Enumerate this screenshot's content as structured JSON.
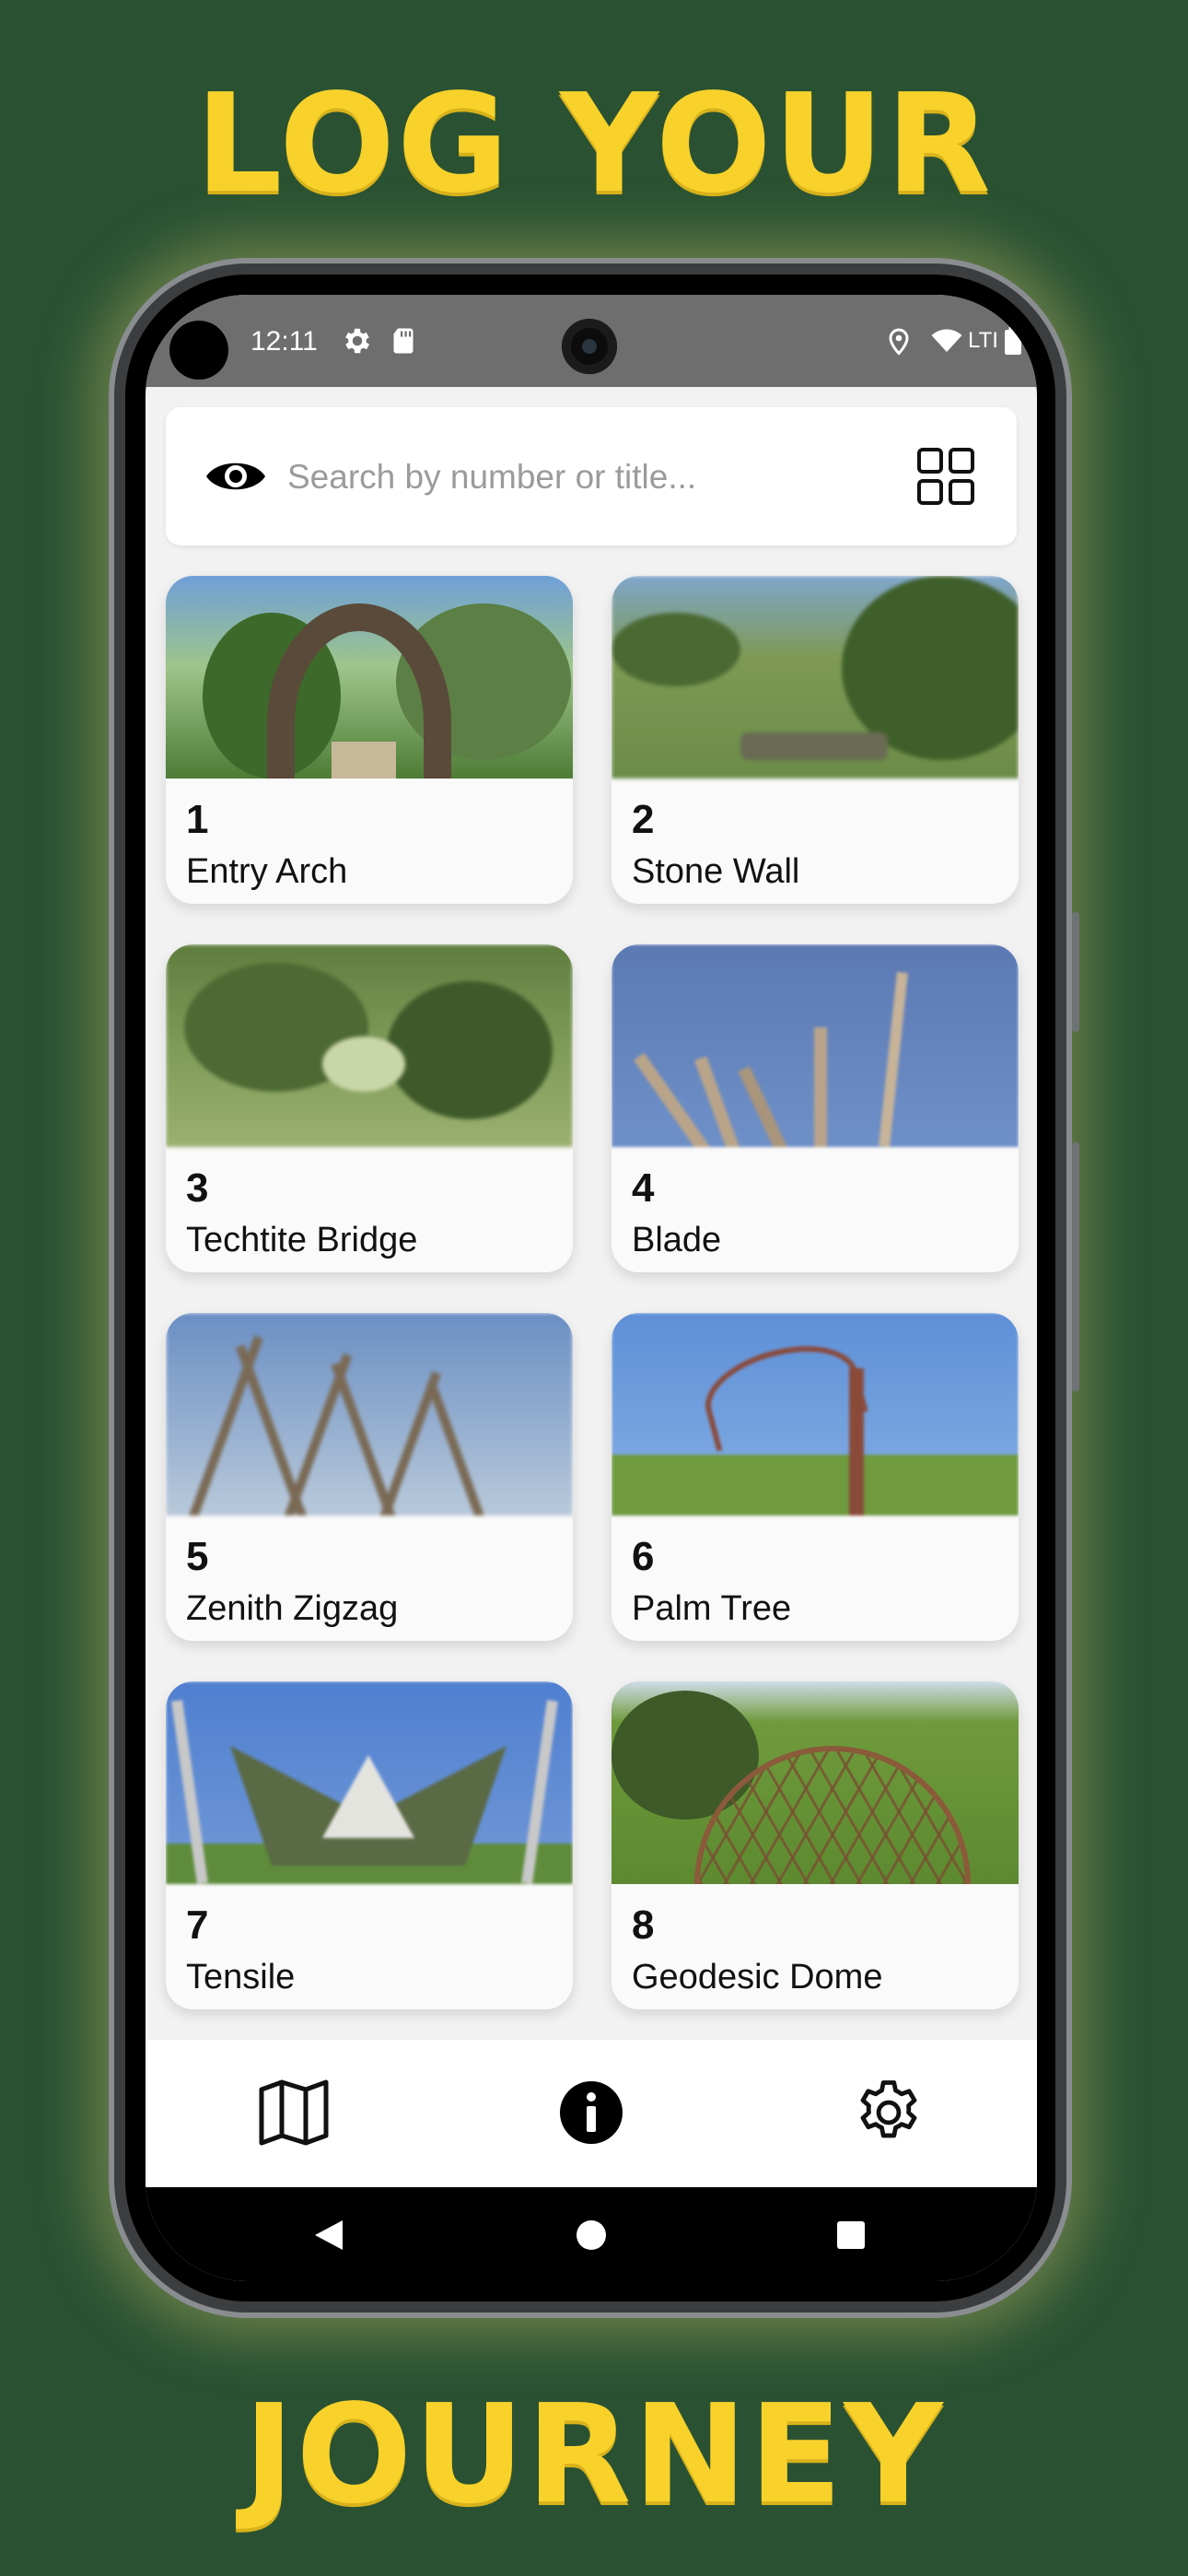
{
  "headline": {
    "top": "LOG YOUR",
    "bottom": "JOURNEY"
  },
  "status_bar": {
    "time": "12:11",
    "network": "LTI",
    "icons": [
      "settings-icon",
      "sd-card-icon",
      "location-icon",
      "wifi-icon",
      "battery-icon"
    ]
  },
  "search": {
    "placeholder": "Search by number or title...",
    "value": ""
  },
  "cards": [
    {
      "number": "1",
      "title": "Entry Arch"
    },
    {
      "number": "2",
      "title": "Stone Wall"
    },
    {
      "number": "3",
      "title": "Techtite Bridge"
    },
    {
      "number": "4",
      "title": "Blade"
    },
    {
      "number": "5",
      "title": "Zenith Zigzag"
    },
    {
      "number": "6",
      "title": "Palm Tree"
    },
    {
      "number": "7",
      "title": "Tensile"
    },
    {
      "number": "8",
      "title": "Geodesic Dome"
    }
  ],
  "bottom_nav": [
    "map-icon",
    "info-icon",
    "settings-icon"
  ],
  "colors": {
    "background": "#2a5232",
    "headline": "#f8d22b",
    "status_bar": "#6e6e6e",
    "card": "#fafafa"
  }
}
